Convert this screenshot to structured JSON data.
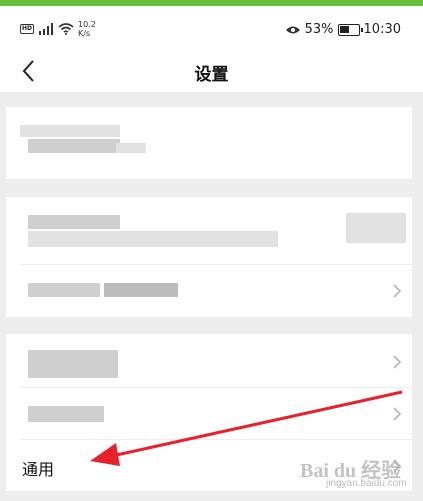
{
  "status_bar": {
    "speed_value": "10.2",
    "speed_unit": "K/s",
    "battery_percent": "53%",
    "time": "10:30",
    "icons": [
      "hd-icon",
      "signal-icon",
      "wifi-icon",
      "eye-icon",
      "battery-icon"
    ]
  },
  "nav": {
    "title": "设置",
    "back_icon": "chevron-left-icon"
  },
  "settings": {
    "general_label": "通用"
  },
  "watermark": {
    "brand": "Bai du 经验",
    "url": "jingyan.baidu.com"
  },
  "colors": {
    "accent": "#6abf3b",
    "annotation_arrow": "#e8202a",
    "background": "#ededed"
  }
}
